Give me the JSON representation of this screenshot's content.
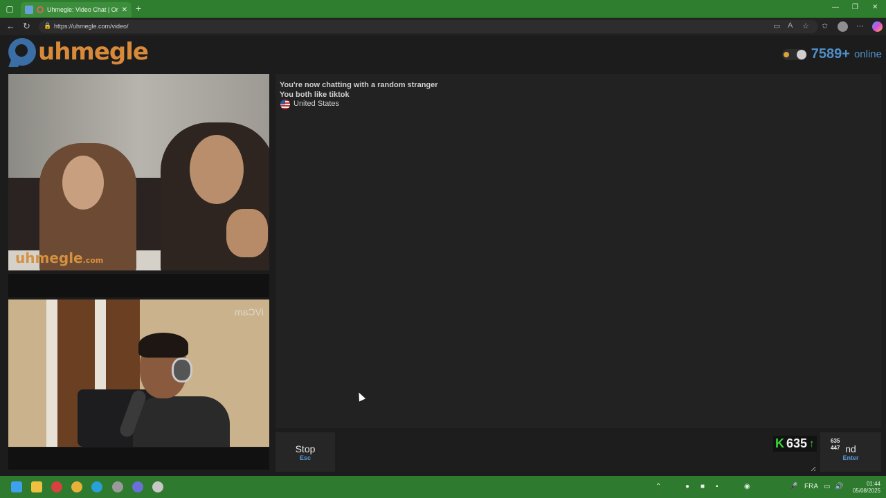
{
  "browser": {
    "tab_title": "Uhmegle: Video Chat | Omeg",
    "tab_close": "✕",
    "new_tab": "+",
    "url": "https://uhmegle.com/video/",
    "win_min": "—",
    "win_max": "❐",
    "win_close": "✕"
  },
  "site": {
    "logo_text": "uhmegle",
    "online_count": "7589+",
    "online_label": "online",
    "watermark_main": "uhmegle",
    "watermark_suffix": ".com",
    "cam_watermark": "iVCam"
  },
  "chat": {
    "line1": "You're now chatting with a random stranger",
    "line2": "You both like tiktok",
    "country": "United States"
  },
  "controls": {
    "stop_label": "Stop",
    "stop_key": "Esc",
    "send_label": "nd",
    "send_key": "Enter",
    "message_placeholder": ""
  },
  "overlay": {
    "k_label": "K",
    "count": "635",
    "arrow": "↑",
    "stat_top": "635",
    "stat_bottom": "447"
  },
  "taskbar": {
    "lang": "FRA",
    "time": "01:44",
    "date": "05/08/2025"
  }
}
